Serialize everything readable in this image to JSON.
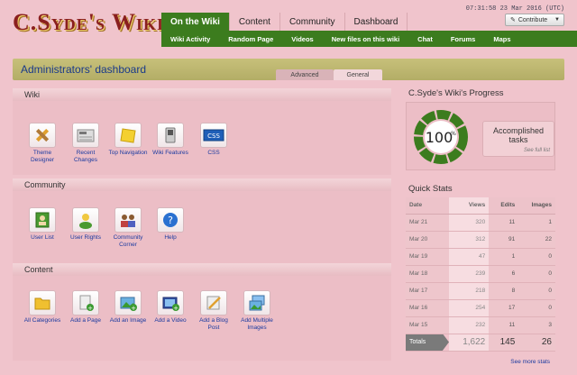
{
  "site": {
    "logo": "C.Syde's Wiki"
  },
  "header": {
    "clock": "07:31:58 23 Mar 2016 (UTC)",
    "contribute_label": "Contribute",
    "tabs": [
      "On the Wiki",
      "Content",
      "Community",
      "Dashboard"
    ],
    "subnav": [
      "Wiki Activity",
      "Random Page",
      "Videos",
      "New files on this wiki",
      "Chat",
      "Forums",
      "Maps"
    ]
  },
  "dashboard": {
    "title": "Administrators' dashboard",
    "subtabs": [
      "Advanced",
      "General"
    ]
  },
  "sections": {
    "wiki": {
      "title": "Wiki",
      "tools": [
        "Theme Designer",
        "Recent Changes",
        "Top Navigation",
        "Wiki Features",
        "CSS"
      ]
    },
    "community": {
      "title": "Community",
      "tools": [
        "User List",
        "User Rights",
        "Community Corner",
        "Help"
      ]
    },
    "content": {
      "title": "Content",
      "tools": [
        "All Categories",
        "Add a Page",
        "Add an Image",
        "Add a Video",
        "Add a Blog Post",
        "Add Multiple Images"
      ]
    }
  },
  "progress": {
    "title": "C.Syde's Wiki's Progress",
    "percent": 100,
    "percent_label": "100",
    "percent_sign": "%",
    "tasks_label": "Accomplished tasks",
    "see_full": "See full list"
  },
  "quick_stats": {
    "title": "Quick Stats",
    "headers": [
      "Date",
      "Views",
      "Edits",
      "Images"
    ],
    "rows": [
      [
        "Mar 21",
        "320",
        "11",
        "1"
      ],
      [
        "Mar 20",
        "312",
        "91",
        "22"
      ],
      [
        "Mar 19",
        "47",
        "1",
        "0"
      ],
      [
        "Mar 18",
        "239",
        "6",
        "0"
      ],
      [
        "Mar 17",
        "218",
        "8",
        "0"
      ],
      [
        "Mar 16",
        "254",
        "17",
        "0"
      ],
      [
        "Mar 15",
        "232",
        "11",
        "3"
      ]
    ],
    "totals": [
      "Totals",
      "1,622",
      "145",
      "26"
    ],
    "see_more": "See more stats"
  },
  "colors": {
    "accent": "#3c7c1e",
    "background": "#f0c4cc",
    "link": "#1a3aa0"
  }
}
